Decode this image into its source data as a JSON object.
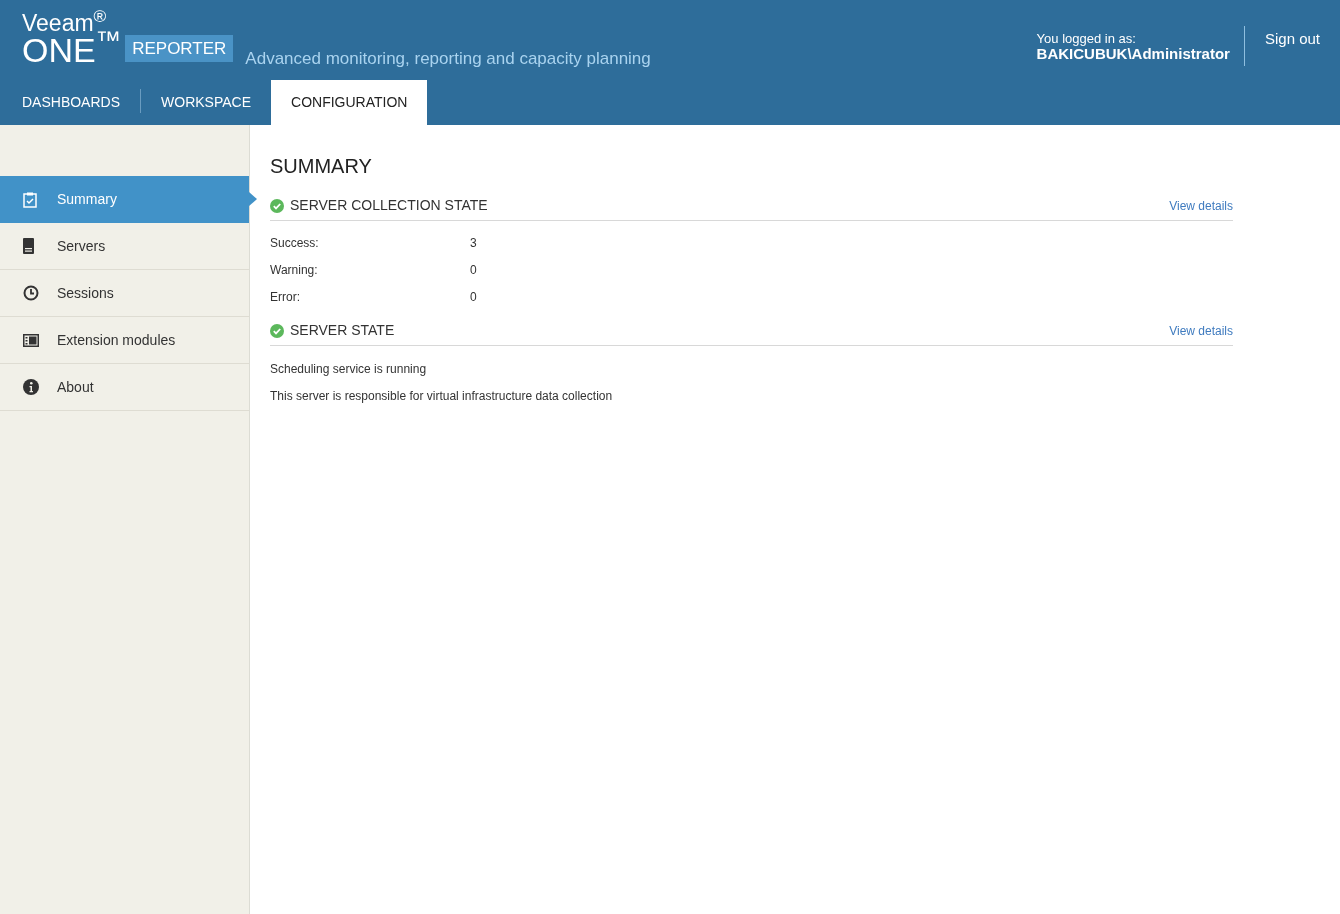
{
  "header": {
    "logo": {
      "brand": "Veeam$^{®}$",
      "product": "ONE$^{™}$",
      "edition": "REPORTER"
    },
    "tagline": "Advanced monitoring, reporting and capacity planning",
    "user_caption": "You logged in as:",
    "user_name": "BAKICUBUK\\Administrator",
    "sign_out": "Sign out"
  },
  "tabs": [
    {
      "label": "DASHBOARDS",
      "selected": false
    },
    {
      "label": "WORKSPACE",
      "selected": false
    },
    {
      "label": "CONFIGURATION",
      "selected": true
    }
  ],
  "sidebar": {
    "items": [
      {
        "label": "Summary",
        "kind": "clipboard",
        "selected": true
      },
      {
        "label": "Servers",
        "kind": "server",
        "selected": false
      },
      {
        "label": "Sessions",
        "kind": "clock",
        "selected": false
      },
      {
        "label": "Extension modules",
        "kind": "module",
        "selected": false
      },
      {
        "label": "About",
        "kind": "info",
        "selected": false
      }
    ]
  },
  "page_title": "SUMMARY",
  "sections": [
    {
      "title": "SERVER COLLECTION STATE",
      "healthy": true,
      "link": "View details",
      "kind": "table",
      "rows": [
        {
          "label": "Success:",
          "value": "3"
        },
        {
          "label": "Warning:",
          "value": "0"
        },
        {
          "label": "Error:",
          "value": "0"
        }
      ]
    },
    {
      "title": "SERVER STATE",
      "healthy": true,
      "link": "View details",
      "kind": "lines",
      "lines": [
        "Scheduling service is running",
        "This server is responsible for virtual infrastructure data collection"
      ]
    }
  ]
}
